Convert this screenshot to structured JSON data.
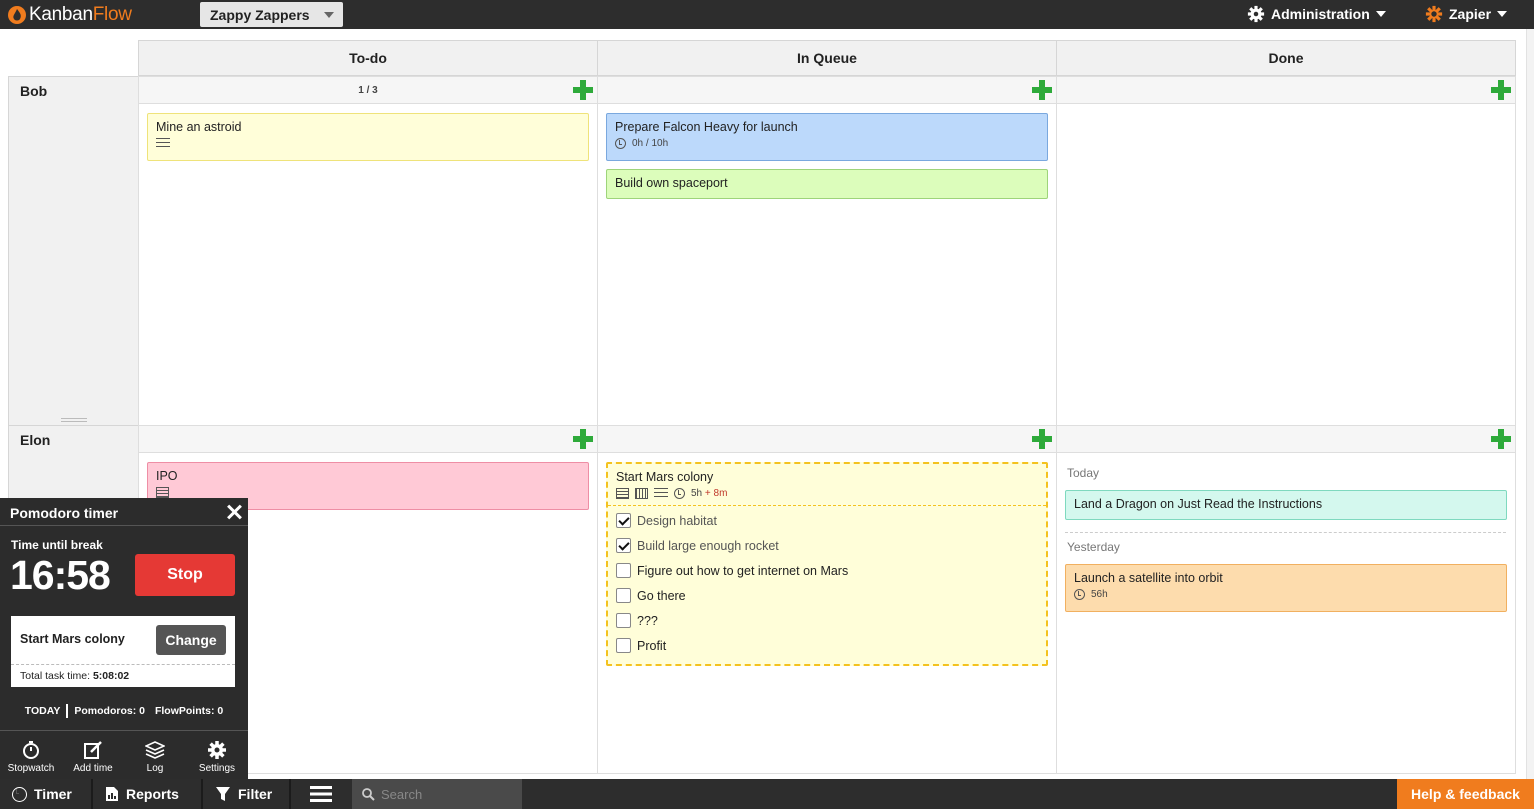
{
  "topbar": {
    "logo_a": "Kanban",
    "logo_b": "Flow",
    "board": "Zappy Zappers",
    "admin": "Administration",
    "user": "Zapier"
  },
  "columns": [
    "To-do",
    "In Queue",
    "Done"
  ],
  "swimlanes": {
    "bob": {
      "name": "Bob",
      "todo_count": "1 / 3",
      "todo": [
        {
          "title": "Mine an astroid"
        }
      ],
      "queue": [
        {
          "title": "Prepare Falcon Heavy for launch",
          "time": "0h / 10h"
        },
        {
          "title": "Build own spaceport"
        }
      ]
    },
    "elon": {
      "name": "Elon",
      "todo": [
        {
          "title": "IPO"
        }
      ],
      "queue": {
        "title": "Start Mars colony",
        "time_a": "5h",
        "time_b": "+ 8m",
        "subtasks": [
          {
            "label": "Design habitat",
            "done": true
          },
          {
            "label": "Build large enough rocket",
            "done": true
          },
          {
            "label": "Figure out how to get internet on Mars",
            "done": false
          },
          {
            "label": "Go there",
            "done": false
          },
          {
            "label": "???",
            "done": false
          },
          {
            "label": "Profit",
            "done": false
          }
        ]
      },
      "done": {
        "today_label": "Today",
        "today_card": "Land a Dragon on Just Read the Instructions",
        "yesterday_label": "Yesterday",
        "yesterday_card": "Launch a satellite into orbit",
        "yesterday_time": "56h"
      }
    }
  },
  "pomodoro": {
    "title": "Pomodoro timer",
    "time_label": "Time until break",
    "time": "16:58",
    "stop": "Stop",
    "task": "Start Mars colony",
    "change": "Change",
    "total_label": "Total task time:",
    "total_value": "5:08:02",
    "today": "TODAY",
    "pomodoros": "Pomodoros: 0",
    "flowpoints": "FlowPoints: 0",
    "actions": [
      "Stopwatch",
      "Add time",
      "Log",
      "Settings"
    ]
  },
  "bottombar": {
    "timer": "Timer",
    "reports": "Reports",
    "filter": "Filter",
    "search_placeholder": "Search",
    "help": "Help & feedback"
  },
  "colors": {
    "accent": "#f07c1e",
    "add": "#2eaa3a",
    "stop": "#e53935",
    "card_yellow": "#fffed9",
    "card_blue": "#bcd9fb",
    "card_green": "#dcfdbb",
    "card_pink": "#ffc9d6",
    "card_teal": "#d4f8ee",
    "card_orange": "#fddcad"
  }
}
